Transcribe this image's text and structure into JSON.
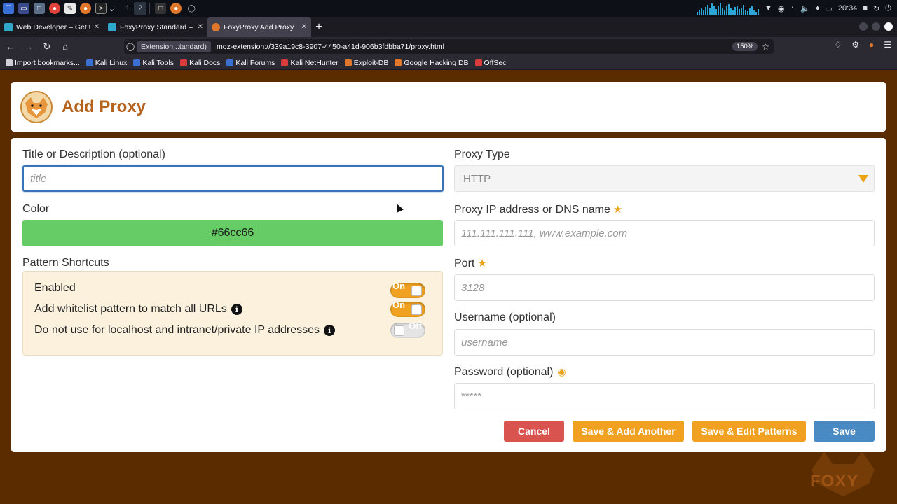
{
  "taskbar": {
    "workspaces": [
      "1",
      "2"
    ],
    "clock": "20:34"
  },
  "browser": {
    "tabs": [
      {
        "label": "Web Developer – Get this",
        "fav_color": "#2fa7c9",
        "active": false
      },
      {
        "label": "FoxyProxy Standard – Get",
        "fav_color": "#2fa7c9",
        "active": false
      },
      {
        "label": "FoxyProxy Add Proxy",
        "fav_color": "#e0772b",
        "active": true
      }
    ],
    "url_chip": "Extension...tandard)",
    "url": "moz-extension://339a19c8-3907-4450-a41d-906b3fdbba71/proxy.html",
    "zoom": "150%",
    "bookmarks": [
      {
        "label": "Import bookmarks...",
        "color": "#cfcfd8"
      },
      {
        "label": "Kali Linux",
        "color": "#3b6fd1"
      },
      {
        "label": "Kali Tools",
        "color": "#3b6fd1"
      },
      {
        "label": "Kali Docs",
        "color": "#d93a3a"
      },
      {
        "label": "Kali Forums",
        "color": "#3b6fd1"
      },
      {
        "label": "Kali NetHunter",
        "color": "#d93a3a"
      },
      {
        "label": "Exploit-DB",
        "color": "#e0772b"
      },
      {
        "label": "Google Hacking DB",
        "color": "#e0772b"
      },
      {
        "label": "OffSec",
        "color": "#d93a3a"
      }
    ]
  },
  "page": {
    "title": "Add Proxy",
    "left": {
      "title_label": "Title or Description (optional)",
      "title_placeholder": "title",
      "color_label": "Color",
      "color_value": "#66cc66",
      "shortcuts_label": "Pattern Shortcuts",
      "shortcuts": [
        {
          "label": "Enabled",
          "state": "On",
          "info": false
        },
        {
          "label": "Add whitelist pattern to match all URLs",
          "state": "On",
          "info": true
        },
        {
          "label": "Do not use for localhost and intranet/private IP addresses",
          "state": "Off",
          "info": true
        }
      ]
    },
    "right": {
      "proxy_type_label": "Proxy Type",
      "proxy_type_value": "HTTP",
      "ip_label": "Proxy IP address or DNS name",
      "ip_placeholder": "111.111.111.111, www.example.com",
      "port_label": "Port",
      "port_placeholder": "3128",
      "username_label": "Username (optional)",
      "username_placeholder": "username",
      "password_label": "Password (optional)",
      "password_placeholder": "*****"
    },
    "buttons": {
      "cancel": "Cancel",
      "save_add_another": "Save & Add Another",
      "save_edit_patterns": "Save & Edit Patterns",
      "save": "Save"
    },
    "watermark": "FOXY"
  },
  "colors": {
    "accent": "#f0a11f",
    "danger": "#d9534f",
    "primary": "#4a8ac4",
    "title": "#b5621d",
    "page_bg": "#5a2c00"
  }
}
